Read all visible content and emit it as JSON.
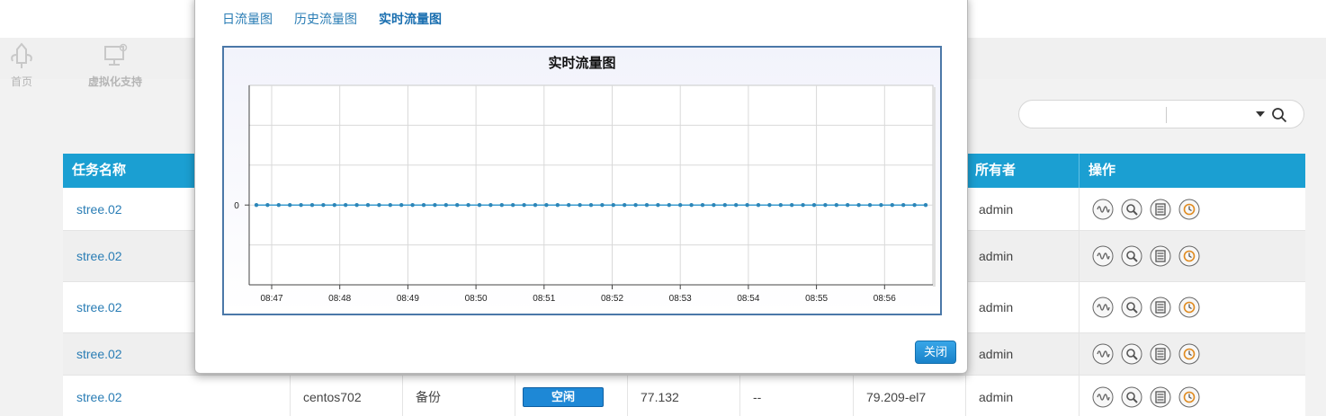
{
  "nav": {
    "home_label": "首页",
    "virt_label": "虚拟化支持"
  },
  "table": {
    "headers": {
      "task_name": "任务名称",
      "owner": "所有者",
      "operations": "操作"
    },
    "rows": [
      {
        "name": "stree.02",
        "owner": "admin"
      },
      {
        "name": "stree.02",
        "owner": "admin"
      },
      {
        "name": "stree.02",
        "owner": "admin"
      },
      {
        "name": "stree.02",
        "owner": "admin"
      },
      {
        "name": "stree.02",
        "host": "centos702",
        "type": "备份",
        "status": "空闲",
        "value": "77.132",
        "extra": "--",
        "version": "79.209-el7",
        "owner": "admin"
      }
    ]
  },
  "modal": {
    "tabs": [
      {
        "label": "日流量图",
        "active": false
      },
      {
        "label": "历史流量图",
        "active": false
      },
      {
        "label": "实时流量图",
        "active": true
      }
    ],
    "close_label": "关闭"
  },
  "chart_data": {
    "type": "line",
    "title": "实时流量图",
    "xlabel": "",
    "ylabel": "",
    "x_tick_labels": [
      "08:47",
      "08:48",
      "08:49",
      "08:50",
      "08:51",
      "08:52",
      "08:53",
      "08:54",
      "08:55",
      "08:56"
    ],
    "y_tick_labels": [
      "0"
    ],
    "series": [
      {
        "values": [
          0,
          0,
          0,
          0,
          0,
          0,
          0,
          0,
          0,
          0,
          0,
          0,
          0,
          0,
          0,
          0,
          0,
          0,
          0,
          0,
          0,
          0,
          0,
          0,
          0,
          0,
          0,
          0,
          0,
          0,
          0,
          0,
          0,
          0,
          0,
          0,
          0,
          0,
          0,
          0,
          0,
          0,
          0,
          0,
          0,
          0,
          0,
          0,
          0,
          0,
          0,
          0,
          0,
          0,
          0,
          0,
          0,
          0,
          0,
          0,
          0
        ]
      }
    ],
    "grid": true,
    "colors": {
      "line": "#3a9ccf",
      "point": "#2c86b8",
      "grid": "#d9d9d9"
    }
  }
}
